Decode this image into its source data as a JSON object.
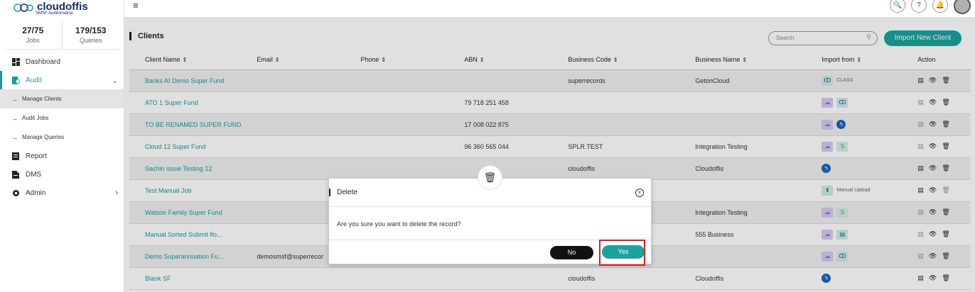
{
  "brand": {
    "name": "cloudoffis",
    "tagline": "SMSF Auditomation"
  },
  "stats": [
    {
      "value": "27/75",
      "label": "Jobs"
    },
    {
      "value": "179/153",
      "label": "Queries"
    }
  ],
  "nav": {
    "dashboard": "Dashboard",
    "audit": "Audit",
    "manage_clients": "Manage Clients",
    "audit_jobs": "Audit Jobs",
    "manage_queries": "Manage Queries",
    "report": "Report",
    "dms": "DMS",
    "admin": "Admin"
  },
  "page": {
    "title": "Clients",
    "search_placeholder": "Search",
    "import_button": "Import New Client"
  },
  "table": {
    "headers": [
      "Client Name",
      "Email",
      "Phone",
      "ABN",
      "Business Code",
      "Business Name",
      "Import from",
      "Action"
    ],
    "rows": [
      {
        "name": "Banks AI Demo Super Fund",
        "email": "",
        "phone": "",
        "abn": "",
        "code": "superrecords",
        "business": "GetonCloud"
      },
      {
        "name": "ATO 1 Super Fund",
        "email": "",
        "phone": "",
        "abn": "79 718 251 458",
        "code": "",
        "business": ""
      },
      {
        "name": "TO BE RENAMED SUPER FUND",
        "email": "",
        "phone": "",
        "abn": "17 008 022 875",
        "code": "",
        "business": ""
      },
      {
        "name": "Cloud 12 Super Fund",
        "email": "",
        "phone": "",
        "abn": "96 360 565 044",
        "code": "SPLR.TEST",
        "business": "Integration Testing"
      },
      {
        "name": "Sachin issue Testing 12",
        "email": "",
        "phone": "",
        "abn": "",
        "code": "cloudoffis",
        "business": "Cloudoffis"
      },
      {
        "name": "Test Manual Job",
        "email": "",
        "phone": "",
        "abn": "",
        "code": "",
        "business": ""
      },
      {
        "name": "Watson Family Super Fund",
        "email": "",
        "phone": "",
        "abn": "",
        "code": "",
        "business": "Integration Testing"
      },
      {
        "name": "Manual Sorted Submit flo...",
        "email": "",
        "phone": "",
        "abn": "",
        "code": "",
        "business": "555 Business"
      },
      {
        "name": "Demo Superannuation Fu...",
        "email": "demosmsf@superrecor",
        "phone": "",
        "abn": "",
        "code": "",
        "business": ""
      },
      {
        "name": "Blank SF",
        "email": "",
        "phone": "",
        "abn": "",
        "code": "cloudoffis",
        "business": "Cloudoffis"
      }
    ],
    "class_label": "CLASS",
    "manual_upload_label": "Manual Upload"
  },
  "modal": {
    "title": "Delete",
    "message": "Are you sure you want to delete the record?",
    "no": "No",
    "yes": "Yes"
  },
  "colors": {
    "accent": "#1aa39f",
    "highlight": "#e01b1b"
  }
}
